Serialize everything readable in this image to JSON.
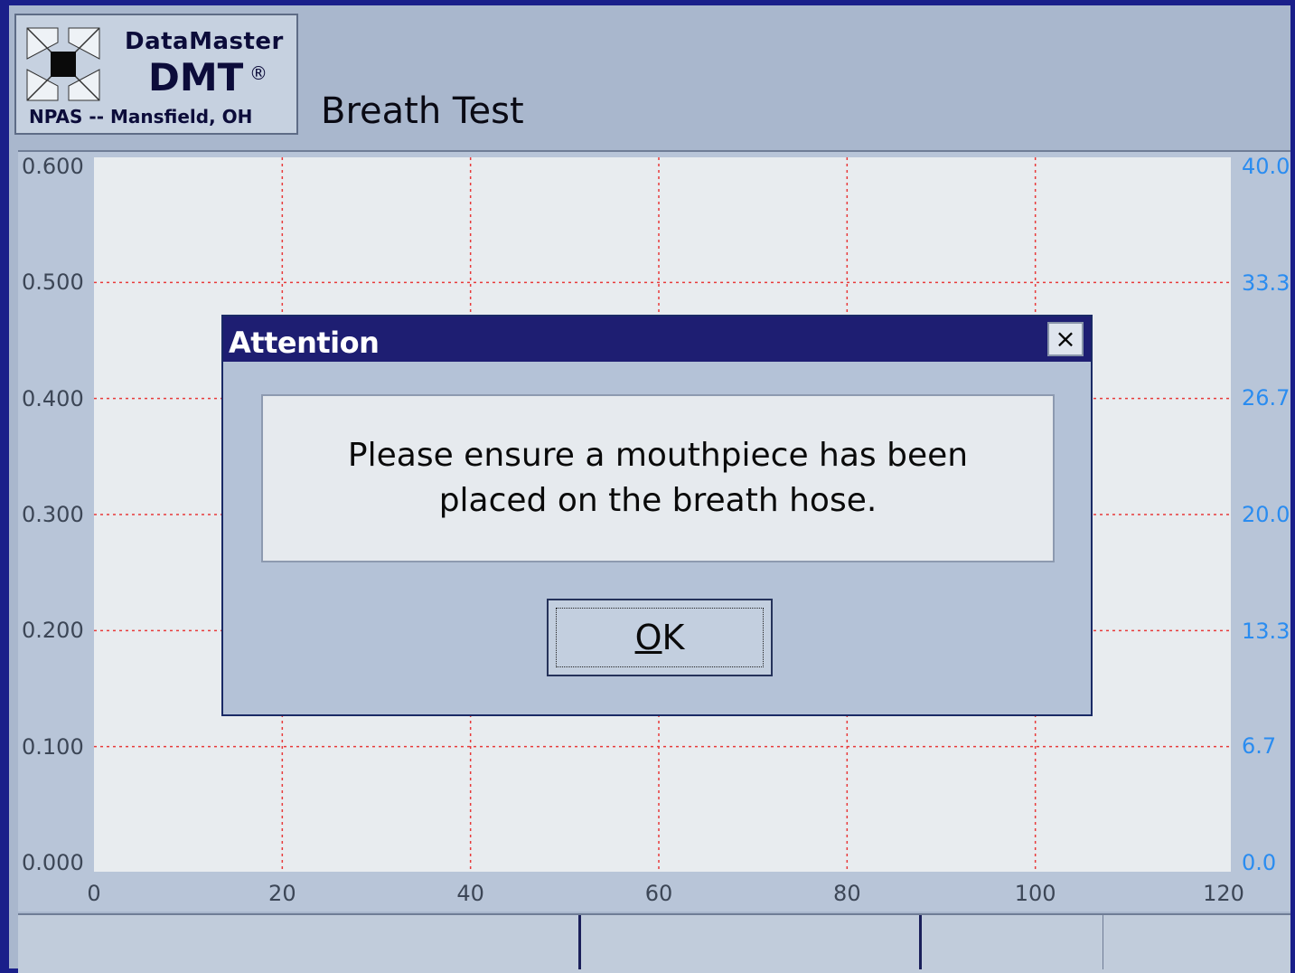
{
  "app": {
    "logo_name": "DataMaster",
    "logo_model": "DMT",
    "logo_reg": "®",
    "logo_location": "NPAS -- Mansfield, OH",
    "screen_title": "Breath Test"
  },
  "chart_data": {
    "type": "line",
    "x_ticks": [
      "0",
      "20",
      "40",
      "60",
      "80",
      "100",
      "120"
    ],
    "xlim": [
      0,
      120
    ],
    "y_left_ticks": [
      "0.000",
      "0.100",
      "0.200",
      "0.300",
      "0.400",
      "0.500",
      "0.600"
    ],
    "ylim_left": [
      0,
      0.6
    ],
    "y_right_ticks": [
      "0.0",
      "6.7",
      "13.3",
      "20.0",
      "26.7",
      "33.3",
      "40.0"
    ],
    "ylim_right": [
      0,
      40
    ],
    "grid": true,
    "grid_color": "#e83a3a",
    "series": []
  },
  "dialog": {
    "title": "Attention",
    "close_label": "×",
    "message": "Please ensure a mouthpiece has been placed on the breath hose.",
    "ok_label": "OK"
  },
  "colors": {
    "screen_bg": "#a9b7cd",
    "dialog_titlebar": "#1e1e72",
    "right_axis": "#2a8cf0"
  }
}
